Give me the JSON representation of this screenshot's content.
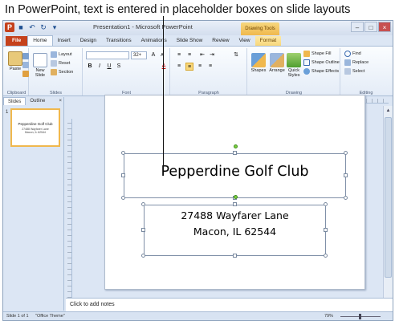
{
  "caption": "In PowerPoint, text is entered in placeholder boxes on slide layouts",
  "window": {
    "title": "Presentation1 - Microsoft PowerPoint",
    "contextual_tab": "Drawing Tools",
    "qat_logo": "P"
  },
  "tabs": [
    "File",
    "Home",
    "Insert",
    "Design",
    "Transitions",
    "Animations",
    "Slide Show",
    "Review",
    "View",
    "Format"
  ],
  "ribbon": {
    "clipboard": {
      "label": "Clipboard",
      "paste": "Paste"
    },
    "slides": {
      "label": "Slides",
      "new_slide": "New Slide",
      "layout": "Layout",
      "reset": "Reset",
      "section": "Section"
    },
    "font": {
      "label": "Font",
      "size": "32+",
      "bold": "B",
      "italic": "I",
      "underline": "U",
      "strike": "S",
      "font_color": "A"
    },
    "paragraph": {
      "label": "Paragraph"
    },
    "drawing": {
      "label": "Drawing",
      "shapes": "Shapes",
      "arrange": "Arrange",
      "quick_styles": "Quick Styles",
      "shape_fill": "Shape Fill",
      "shape_outline": "Shape Outline",
      "shape_effects": "Shape Effects"
    },
    "editing": {
      "label": "Editing",
      "find": "Find",
      "replace": "Replace",
      "select": "Select"
    }
  },
  "left_pane": {
    "tabs": [
      "Slides",
      "Outline"
    ],
    "close": "×",
    "slide_number": "1",
    "thumb_title": "Pepperdine Golf Club",
    "thumb_line1": "27488 Wayfarer Lane",
    "thumb_line2": "Macon, IL 62544"
  },
  "slide": {
    "title": "Pepperdine Golf Club",
    "body_lines": [
      "27488 Wayfarer  Lane",
      "Macon, IL 62544"
    ]
  },
  "notes_placeholder": "Click to add notes",
  "status": {
    "slide": "Slide 1 of 1",
    "theme": "\"Office Theme\"",
    "zoom": "79%"
  },
  "colors": {
    "file_tab": "#c5411b",
    "accent_gold": "#f8d77a",
    "frame": "#dce6f4"
  }
}
